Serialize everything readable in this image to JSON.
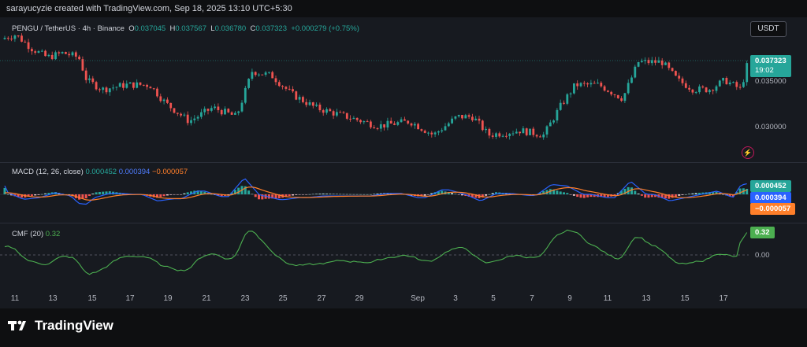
{
  "header": {
    "text": "sarayucyzie created with TradingView.com, Sep 18, 2025 13:10 UTC+5:30"
  },
  "main_legend": {
    "symbol": "PENGU / TetherUS · 4h · Binance",
    "o_label": "O",
    "o_value": "0.037045",
    "h_label": "H",
    "h_value": "0.037567",
    "l_label": "L",
    "l_value": "0.036780",
    "c_label": "C",
    "c_value": "0.037323",
    "change": "+0.000279 (+0.75%)"
  },
  "currency_button": "USDT",
  "price_axis": {
    "current_price": "0.037323",
    "countdown": "19:02",
    "labels": [
      "0.035000",
      "0.030000"
    ]
  },
  "macd": {
    "title": "MACD (12, 26, close)",
    "macd_value": "0.000452",
    "signal_value": "0.000394",
    "hist_value": "−0.000057",
    "tags": [
      "0.000452",
      "0.000394",
      "−0.000057"
    ]
  },
  "cmf": {
    "title": "CMF (20)",
    "value": "0.32",
    "tag": "0.32",
    "zero_label": "0.00"
  },
  "time_axis": [
    "11",
    "13",
    "15",
    "17",
    "19",
    "21",
    "23",
    "25",
    "27",
    "29",
    "Sep",
    "3",
    "5",
    "7",
    "9",
    "11",
    "13",
    "15",
    "17"
  ],
  "footer": {
    "brand": "TradingView"
  },
  "colors": {
    "up": "#26a69a",
    "down": "#ef5350",
    "macd": "#2962ff",
    "signal": "#ff7f2a",
    "cmf": "#4caf50",
    "bg": "#171a20"
  }
}
